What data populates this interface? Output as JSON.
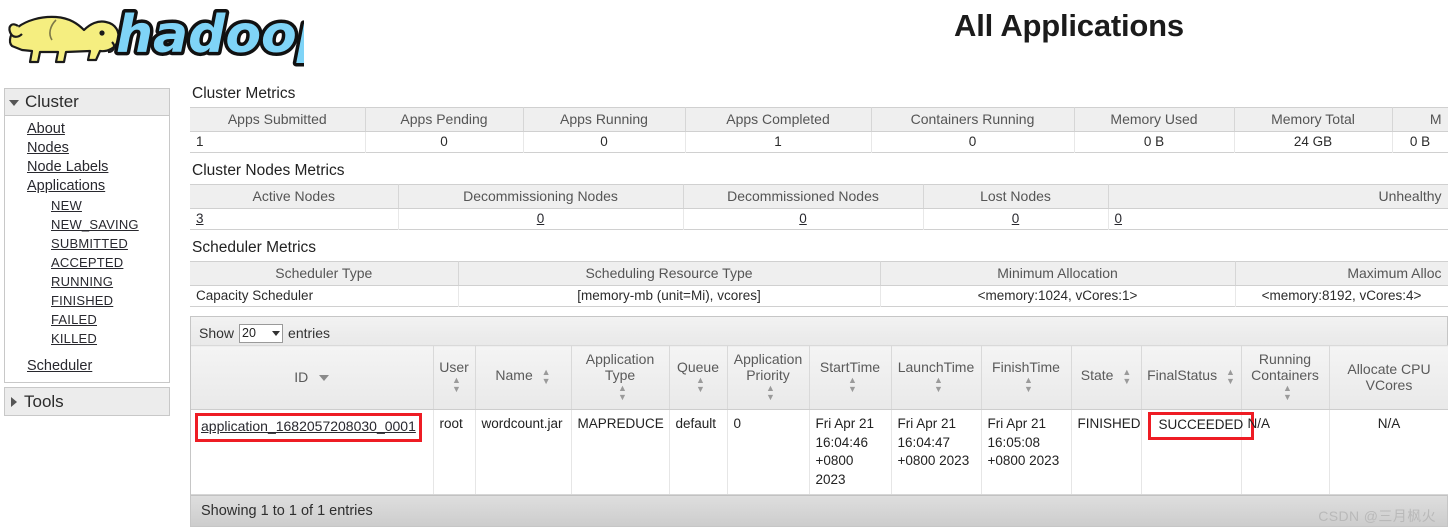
{
  "header": {
    "logo_alt": "hadoop-logo",
    "title": "All Applications"
  },
  "sidebar": {
    "cluster": {
      "label": "Cluster",
      "items": [
        {
          "label": "About",
          "level": 1
        },
        {
          "label": "Nodes",
          "level": 1
        },
        {
          "label": "Node Labels",
          "level": 1
        },
        {
          "label": "Applications",
          "level": 1
        },
        {
          "label": "NEW",
          "level": 2
        },
        {
          "label": "NEW_SAVING",
          "level": 2
        },
        {
          "label": "SUBMITTED",
          "level": 2
        },
        {
          "label": "ACCEPTED",
          "level": 2
        },
        {
          "label": "RUNNING",
          "level": 2
        },
        {
          "label": "FINISHED",
          "level": 2
        },
        {
          "label": "FAILED",
          "level": 2
        },
        {
          "label": "KILLED",
          "level": 2
        },
        {
          "label": "Scheduler",
          "level": 1,
          "spaced": true
        }
      ]
    },
    "tools": {
      "label": "Tools"
    }
  },
  "cluster_metrics": {
    "title": "Cluster Metrics",
    "columns": [
      "Apps Submitted",
      "Apps Pending",
      "Apps Running",
      "Apps Completed",
      "Containers Running",
      "Memory Used",
      "Memory Total",
      "M"
    ],
    "values": [
      "1",
      "0",
      "0",
      "1",
      "0",
      "0 B",
      "24 GB",
      "0 B"
    ]
  },
  "cluster_nodes_metrics": {
    "title": "Cluster Nodes Metrics",
    "columns": [
      "Active Nodes",
      "Decommissioning Nodes",
      "Decommissioned Nodes",
      "Lost Nodes",
      "Unhealthy"
    ],
    "values": [
      "3",
      "0",
      "0",
      "0",
      "0"
    ]
  },
  "scheduler_metrics": {
    "title": "Scheduler Metrics",
    "columns": [
      "Scheduler Type",
      "Scheduling Resource Type",
      "Minimum Allocation",
      "Maximum Alloc"
    ],
    "values": [
      "Capacity Scheduler",
      "[memory-mb (unit=Mi), vcores]",
      "<memory:1024, vCores:1>",
      "<memory:8192, vCores:4>"
    ]
  },
  "apps_table": {
    "show_label": "Show",
    "length_value": "20",
    "entries_label": "entries",
    "columns": [
      {
        "label": "ID",
        "sort": "desc"
      },
      {
        "label": "User",
        "sort": "both"
      },
      {
        "label": "Name",
        "sort": "both"
      },
      {
        "label": "Application Type",
        "sort": "both"
      },
      {
        "label": "Queue",
        "sort": "both"
      },
      {
        "label": "Application Priority",
        "sort": "both"
      },
      {
        "label": "StartTime",
        "sort": "both"
      },
      {
        "label": "LaunchTime",
        "sort": "both"
      },
      {
        "label": "FinishTime",
        "sort": "both"
      },
      {
        "label": "State",
        "sort": "both"
      },
      {
        "label": "FinalStatus",
        "sort": "both"
      },
      {
        "label": "Running Containers",
        "sort": "both"
      },
      {
        "label": "Allocate CPU VCores",
        "sort": "none"
      }
    ],
    "rows": [
      {
        "id": "application_1682057208030_0001",
        "user": "root",
        "name": "wordcount.jar",
        "application_type": "MAPREDUCE",
        "queue": "default",
        "application_priority": "0",
        "start_time": "Fri Apr 21 16:04:46 +0800 2023",
        "launch_time": "Fri Apr 21 16:04:47 +0800 2023",
        "finish_time": "Fri Apr 21 16:05:08 +0800 2023",
        "state": "FINISHED",
        "final_status": "SUCCEEDED",
        "running_containers": "N/A",
        "allocated_cpu_vcores": "N/A"
      }
    ],
    "footer": "Showing 1 to 1 of 1 entries"
  },
  "watermark": "CSDN @三月枫火",
  "colors": {
    "annotation": "#ee1c24",
    "logo_blue": "#7fd4f7",
    "logo_yellow": "#f5ee80"
  }
}
